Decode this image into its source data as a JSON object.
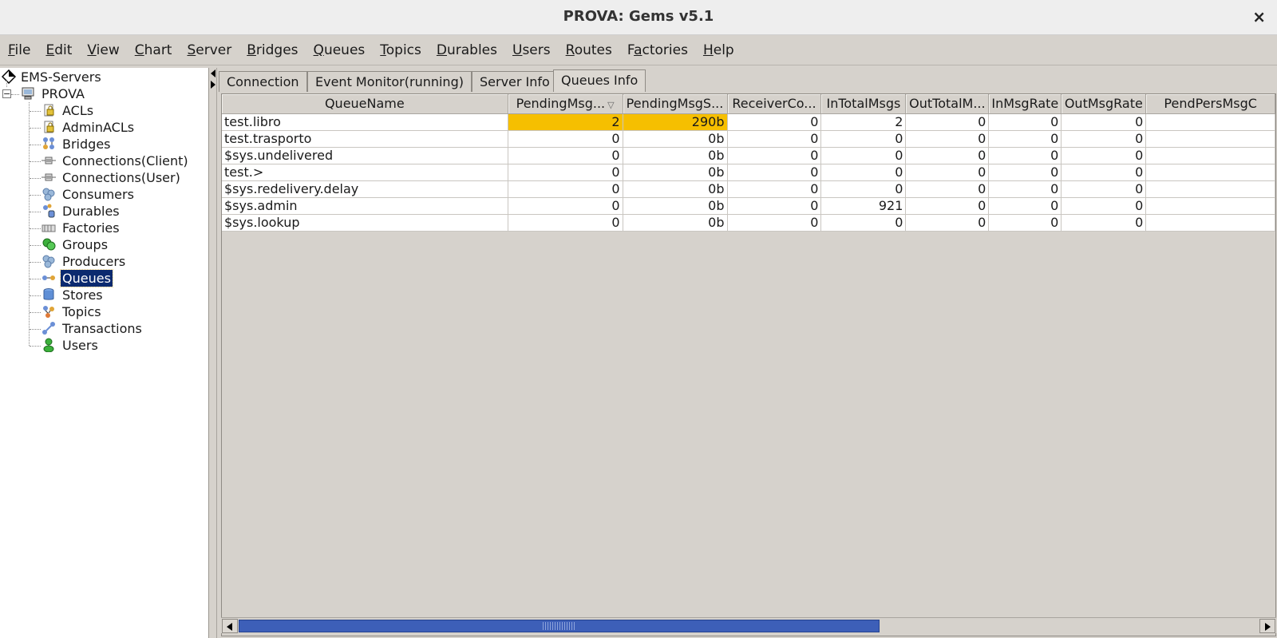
{
  "window": {
    "title": "PROVA: Gems v5.1",
    "close_glyph": "×"
  },
  "menu": [
    {
      "mn": "F",
      "rest": "ile"
    },
    {
      "mn": "E",
      "rest": "dit"
    },
    {
      "mn": "V",
      "rest": "iew"
    },
    {
      "mn": "C",
      "rest": "hart"
    },
    {
      "mn": "S",
      "rest": "erver"
    },
    {
      "mn": "B",
      "rest": "ridges"
    },
    {
      "mn": "Q",
      "rest": "ueues"
    },
    {
      "mn": "T",
      "rest": "opics"
    },
    {
      "mn": "D",
      "rest": "urables"
    },
    {
      "mn": "U",
      "rest": "sers"
    },
    {
      "mn": "R",
      "rest": "outes"
    },
    {
      "pre": "F",
      "mn": "a",
      "rest": "ctories"
    },
    {
      "mn": "H",
      "rest": "elp"
    }
  ],
  "tree": {
    "root": "EMS-Servers",
    "server": "PROVA",
    "items": [
      {
        "label": "ACLs",
        "icon": "lock-icon"
      },
      {
        "label": "AdminACLs",
        "icon": "lock-icon"
      },
      {
        "label": "Bridges",
        "icon": "bridge-icon"
      },
      {
        "label": "Connections(Client)",
        "icon": "connection-icon"
      },
      {
        "label": "Connections(User)",
        "icon": "connection-icon"
      },
      {
        "label": "Consumers",
        "icon": "gears-icon"
      },
      {
        "label": "Durables",
        "icon": "durable-icon"
      },
      {
        "label": "Factories",
        "icon": "factory-icon"
      },
      {
        "label": "Groups",
        "icon": "group-icon"
      },
      {
        "label": "Producers",
        "icon": "gears-icon"
      },
      {
        "label": "Queues",
        "icon": "queue-icon",
        "selected": true
      },
      {
        "label": "Stores",
        "icon": "database-icon"
      },
      {
        "label": "Topics",
        "icon": "topic-icon"
      },
      {
        "label": "Transactions",
        "icon": "transaction-icon"
      },
      {
        "label": "Users",
        "icon": "user-icon"
      }
    ]
  },
  "tabs": [
    {
      "label": "Connection"
    },
    {
      "label": "Event Monitor(running)"
    },
    {
      "label": "Server Info"
    },
    {
      "label": "Queues Info",
      "active": true
    }
  ],
  "table": {
    "columns": [
      "QueueName",
      "PendingMsg...",
      "PendingMsgS...",
      "ReceiverCo...",
      "InTotalMsgs",
      "OutTotalM...",
      "InMsgRate",
      "OutMsgRate",
      "PendPersMsgC"
    ],
    "sort_indicator": "▽",
    "rows": [
      [
        "test.libro",
        "2",
        "290b",
        "0",
        "2",
        "0",
        "0",
        "0",
        ""
      ],
      [
        "test.trasporto",
        "0",
        "0b",
        "0",
        "0",
        "0",
        "0",
        "0",
        ""
      ],
      [
        "$sys.undelivered",
        "0",
        "0b",
        "0",
        "0",
        "0",
        "0",
        "0",
        ""
      ],
      [
        "test.>",
        "0",
        "0b",
        "0",
        "0",
        "0",
        "0",
        "0",
        ""
      ],
      [
        "$sys.redelivery.delay",
        "0",
        "0b",
        "0",
        "0",
        "0",
        "0",
        "0",
        ""
      ],
      [
        "$sys.admin",
        "0",
        "0b",
        "0",
        "921",
        "0",
        "0",
        "0",
        ""
      ],
      [
        "$sys.lookup",
        "0",
        "0b",
        "0",
        "0",
        "0",
        "0",
        "0",
        ""
      ]
    ],
    "highlight_color": "#f6bf00"
  }
}
